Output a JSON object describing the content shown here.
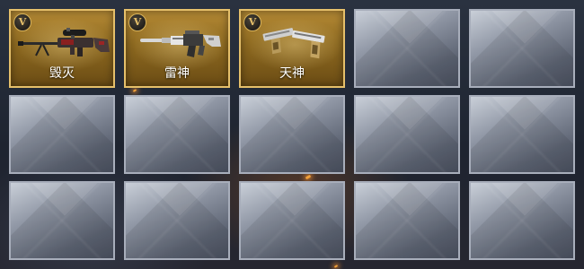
{
  "inventory": {
    "slots": [
      {
        "state": "filled",
        "name": "毁灭",
        "badge": "V",
        "icon": "sniper-rifle-icon"
      },
      {
        "state": "filled",
        "name": "雷神",
        "badge": "V",
        "icon": "assault-rifle-icon"
      },
      {
        "state": "filled",
        "name": "天神",
        "badge": "V",
        "icon": "dual-pistols-icon"
      },
      {
        "state": "empty"
      },
      {
        "state": "empty"
      },
      {
        "state": "empty"
      },
      {
        "state": "empty"
      },
      {
        "state": "empty"
      },
      {
        "state": "empty"
      },
      {
        "state": "empty"
      },
      {
        "state": "empty"
      },
      {
        "state": "empty"
      },
      {
        "state": "empty"
      },
      {
        "state": "empty"
      },
      {
        "state": "empty"
      }
    ]
  },
  "colors": {
    "gold_border": "#e6c06a",
    "gold_background": "#8d6920",
    "empty_slot": "#939aa8",
    "empty_border": "#a8aebb"
  }
}
